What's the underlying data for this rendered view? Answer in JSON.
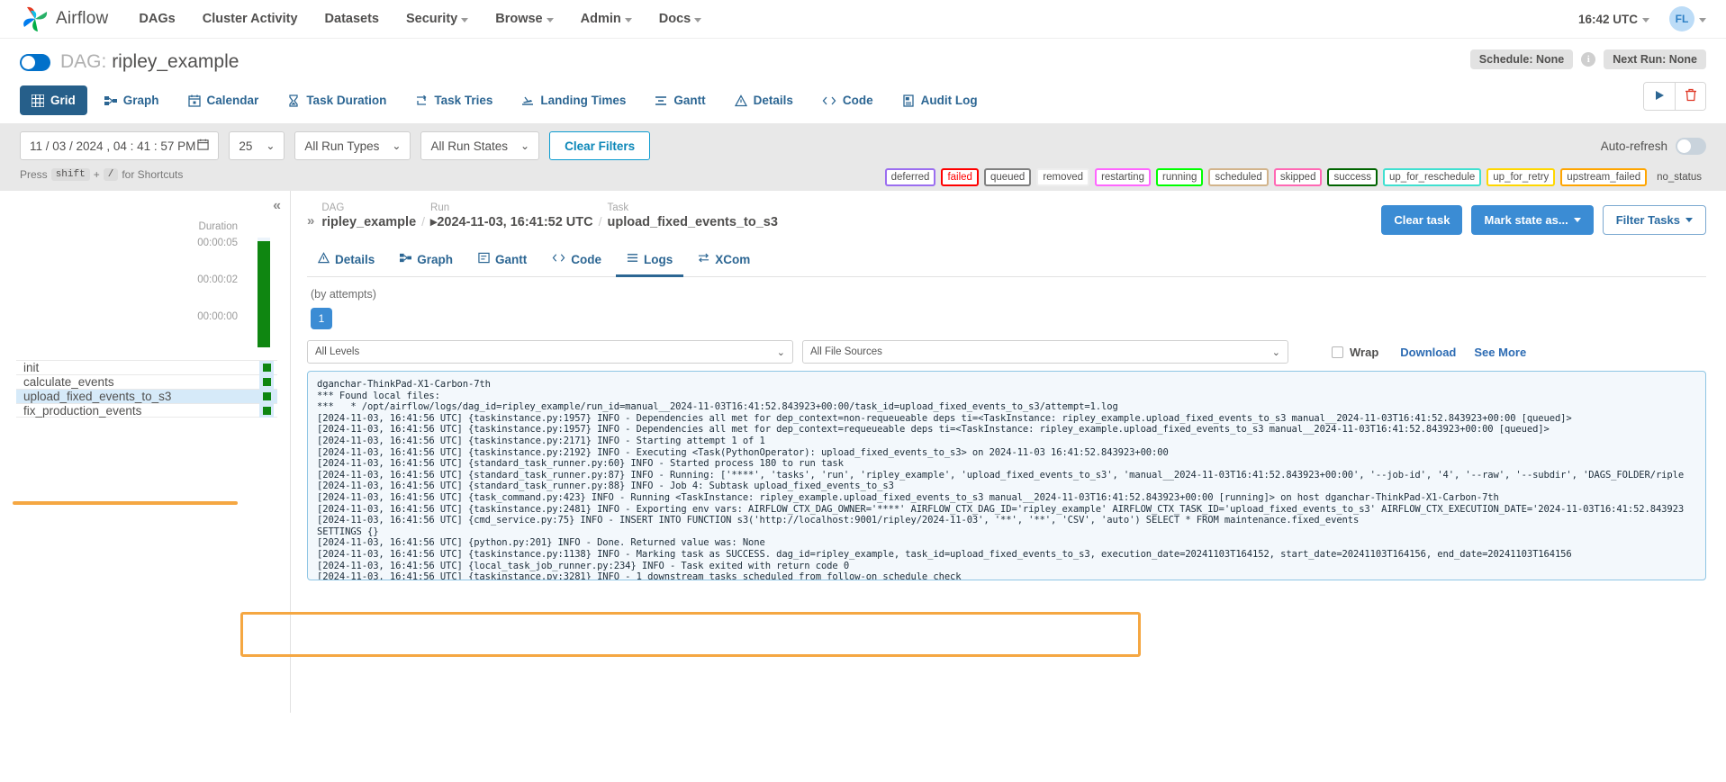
{
  "navbar": {
    "brand": "Airflow",
    "links": [
      {
        "label": "DAGs",
        "caret": false
      },
      {
        "label": "Cluster Activity",
        "caret": false
      },
      {
        "label": "Datasets",
        "caret": false
      },
      {
        "label": "Security",
        "caret": true
      },
      {
        "label": "Browse",
        "caret": true
      },
      {
        "label": "Admin",
        "caret": true
      },
      {
        "label": "Docs",
        "caret": true
      }
    ],
    "clock": "16:42 UTC",
    "avatar_initials": "FL"
  },
  "dag_header": {
    "prefix": "DAG:",
    "name": "ripley_example",
    "schedule_chip": "Schedule: None",
    "info_glyph": "i",
    "next_run_chip": "Next Run: None"
  },
  "view_tabs": [
    {
      "label": "Grid",
      "icon": "grid-icon",
      "active": true
    },
    {
      "label": "Graph",
      "icon": "graph-icon",
      "active": false
    },
    {
      "label": "Calendar",
      "icon": "calendar-icon",
      "active": false
    },
    {
      "label": "Task Duration",
      "icon": "hourglass-icon",
      "active": false
    },
    {
      "label": "Task Tries",
      "icon": "retry-icon",
      "active": false
    },
    {
      "label": "Landing Times",
      "icon": "landing-icon",
      "active": false
    },
    {
      "label": "Gantt",
      "icon": "gantt-icon",
      "active": false
    },
    {
      "label": "Details",
      "icon": "warning-triangle-icon",
      "active": false
    },
    {
      "label": "Code",
      "icon": "code-icon",
      "active": false
    },
    {
      "label": "Audit Log",
      "icon": "audit-icon",
      "active": false
    }
  ],
  "run_actions": {
    "trigger": "play-icon",
    "delete": "trash-icon"
  },
  "filters": {
    "date_value": "11 / 03 / 2024 ,  04 : 41 : 57  PM",
    "page_size": "25",
    "run_types": "All Run Types",
    "run_states": "All Run States",
    "clear_label": "Clear Filters",
    "auto_refresh_label": "Auto-refresh"
  },
  "shortcut": {
    "prefix": "Press",
    "key1": "shift",
    "plus": "+",
    "key2": "/",
    "suffix": "for Shortcuts"
  },
  "legend": [
    {
      "label": "deferred",
      "color": "#9b6ef0"
    },
    {
      "label": "failed",
      "color": "#ff0000"
    },
    {
      "label": "queued",
      "color": "#808080"
    },
    {
      "label": "removed",
      "color": "#eeeeee"
    },
    {
      "label": "restarting",
      "color": "#ff66ff"
    },
    {
      "label": "running",
      "color": "#00ff00"
    },
    {
      "label": "scheduled",
      "color": "#d2b48c"
    },
    {
      "label": "skipped",
      "color": "#ff69b4"
    },
    {
      "label": "success",
      "color": "#006400"
    },
    {
      "label": "up_for_reschedule",
      "color": "#40e0d0"
    },
    {
      "label": "up_for_retry",
      "color": "#ffd700"
    },
    {
      "label": "upstream_failed",
      "color": "#ffa500"
    },
    {
      "label": "no_status",
      "color": "transparent"
    }
  ],
  "grid_pane": {
    "collapse_glyph": "«",
    "duration_label": "Duration",
    "ticks": [
      "00:00:05",
      "00:00:02",
      "00:00:00"
    ],
    "bar_color": "#0f8611",
    "tasks": [
      {
        "name": "init",
        "state": "success",
        "selected": false
      },
      {
        "name": "calculate_events",
        "state": "success",
        "selected": false
      },
      {
        "name": "upload_fixed_events_to_s3",
        "state": "success",
        "selected": true
      },
      {
        "name": "fix_production_events",
        "state": "success",
        "selected": false
      }
    ]
  },
  "detail": {
    "arrows": "»",
    "dag_caption": "DAG",
    "dag_value": "ripley_example",
    "run_caption": "Run",
    "run_value": "2024-11-03, 16:41:52 UTC",
    "task_caption": "Task",
    "task_value": "upload_fixed_events_to_s3",
    "clear_task": "Clear task",
    "mark_state": "Mark state as...",
    "filter_tasks": "Filter Tasks",
    "tabs": [
      {
        "label": "Details",
        "icon": "warning-triangle-icon",
        "active": false
      },
      {
        "label": "Graph",
        "icon": "graph-icon",
        "active": false
      },
      {
        "label": "Gantt",
        "icon": "gantt-icon",
        "active": false
      },
      {
        "label": "Code",
        "icon": "code-icon",
        "active": false
      },
      {
        "label": "Logs",
        "icon": "logs-icon",
        "active": true
      },
      {
        "label": "XCom",
        "icon": "xcom-icon",
        "active": false
      }
    ],
    "by_attempts": "(by attempts)",
    "attempt_number": "1",
    "level_filter": "All Levels",
    "source_filter": "All File Sources",
    "wrap_label": "Wrap",
    "download_label": "Download",
    "see_more_label": "See More"
  },
  "log_lines": [
    "dganchar-ThinkPad-X1-Carbon-7th",
    "*** Found local files:",
    "***   * /opt/airflow/logs/dag_id=ripley_example/run_id=manual__2024-11-03T16:41:52.843923+00:00/task_id=upload_fixed_events_to_s3/attempt=1.log",
    "[2024-11-03, 16:41:56 UTC] {taskinstance.py:1957} INFO - Dependencies all met for dep_context=non-requeueable deps ti=<TaskInstance: ripley_example.upload_fixed_events_to_s3 manual__2024-11-03T16:41:52.843923+00:00 [queued]>",
    "[2024-11-03, 16:41:56 UTC] {taskinstance.py:1957} INFO - Dependencies all met for dep_context=requeueable deps ti=<TaskInstance: ripley_example.upload_fixed_events_to_s3 manual__2024-11-03T16:41:52.843923+00:00 [queued]>",
    "[2024-11-03, 16:41:56 UTC] {taskinstance.py:2171} INFO - Starting attempt 1 of 1",
    "[2024-11-03, 16:41:56 UTC] {taskinstance.py:2192} INFO - Executing <Task(PythonOperator): upload_fixed_events_to_s3> on 2024-11-03 16:41:52.843923+00:00",
    "[2024-11-03, 16:41:56 UTC] {standard_task_runner.py:60} INFO - Started process 180 to run task",
    "[2024-11-03, 16:41:56 UTC] {standard_task_runner.py:87} INFO - Running: ['****', 'tasks', 'run', 'ripley_example', 'upload_fixed_events_to_s3', 'manual__2024-11-03T16:41:52.843923+00:00', '--job-id', '4', '--raw', '--subdir', 'DAGS_FOLDER/riple",
    "[2024-11-03, 16:41:56 UTC] {standard_task_runner.py:88} INFO - Job 4: Subtask upload_fixed_events_to_s3",
    "[2024-11-03, 16:41:56 UTC] {task_command.py:423} INFO - Running <TaskInstance: ripley_example.upload_fixed_events_to_s3 manual__2024-11-03T16:41:52.843923+00:00 [running]> on host dganchar-ThinkPad-X1-Carbon-7th",
    "[2024-11-03, 16:41:56 UTC] {taskinstance.py:2481} INFO - Exporting env vars: AIRFLOW_CTX_DAG_OWNER='****' AIRFLOW_CTX_DAG_ID='ripley_example' AIRFLOW_CTX_TASK_ID='upload_fixed_events_to_s3' AIRFLOW_CTX_EXECUTION_DATE='2024-11-03T16:41:52.843923",
    "[2024-11-03, 16:41:56 UTC] {cmd_service.py:75} INFO - INSERT INTO FUNCTION s3('http://localhost:9001/ripley/2024-11-03', '**', '**', 'CSV', 'auto') SELECT * FROM maintenance.fixed_events",
    "SETTINGS {}",
    "[2024-11-03, 16:41:56 UTC] {python.py:201} INFO - Done. Returned value was: None",
    "[2024-11-03, 16:41:56 UTC] {taskinstance.py:1138} INFO - Marking task as SUCCESS. dag_id=ripley_example, task_id=upload_fixed_events_to_s3, execution_date=20241103T164152, start_date=20241103T164156, end_date=20241103T164156",
    "[2024-11-03, 16:41:56 UTC] {local_task_job_runner.py:234} INFO - Task exited with return code 0",
    "[2024-11-03, 16:41:56 UTC] {taskinstance.py:3281} INFO - 1 downstream tasks scheduled from follow-on schedule check"
  ]
}
